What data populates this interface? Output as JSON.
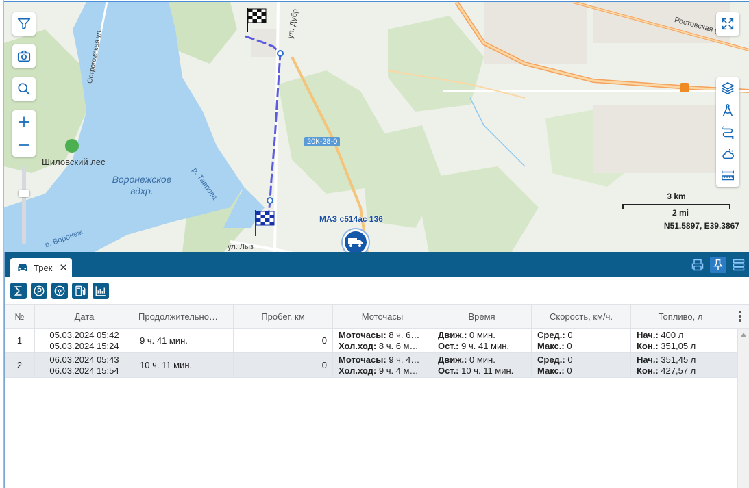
{
  "map": {
    "labels": {
      "shilovsky_les": "Шиловский лес",
      "reservoir": "Воронежское вдхр.",
      "tavrova": "р. Таврова",
      "voronezh_river": "р. Воронеж",
      "ostrogozhskaya": "Острогожская ул.",
      "rostovskaya": "Ростовская ул.",
      "dubr": "ул. Дубр",
      "lyzo": "ул. Лыз",
      "road_badge": "20К-28-0"
    },
    "vehicle_label": "МАЗ с514ас 136",
    "scale_km": "3 km",
    "scale_mi": "2 mi",
    "coords": "N51.5897, E39.3867"
  },
  "panel": {
    "tab_label": "Трек",
    "tab_close": "✕"
  },
  "grid": {
    "headers": [
      "№",
      "Дата",
      "Продолжительно…",
      "Пробег, км",
      "Моточасы",
      "Время",
      "Скорость, км/ч.",
      "Топливо, л"
    ],
    "rows": [
      {
        "num": "1",
        "date_start": "05.03.2024 05:42",
        "date_end": "05.03.2024 15:24",
        "duration": "9 ч. 41 мин.",
        "mileage": "0",
        "moto_label": "Моточасы:",
        "moto_value": " 8 ч. 6…",
        "idle_label": "Хол.ход:",
        "idle_value": " 8 ч. 6 м…",
        "move_label": "Движ.:",
        "move_value": " 0 мин.",
        "stop_label": "Ост.:",
        "stop_value": " 9 ч. 41 мин.",
        "avg_label": "Сред.:",
        "avg_value": " 0",
        "max_label": "Макс.:",
        "max_value": " 0",
        "fuel_start_label": "Нач.:",
        "fuel_start_value": " 400 л",
        "fuel_end_label": "Кон.:",
        "fuel_end_value": " 351,05 л"
      },
      {
        "num": "2",
        "date_start": "06.03.2024 05:43",
        "date_end": "06.03.2024 15:54",
        "duration": "10 ч. 11 мин.",
        "mileage": "0",
        "moto_label": "Моточасы:",
        "moto_value": " 9 ч. 4…",
        "idle_label": "Хол.ход:",
        "idle_value": " 9 ч. 4 м…",
        "move_label": "Движ.:",
        "move_value": " 0 мин.",
        "stop_label": "Ост.:",
        "stop_value": " 10 ч. 11 мин.",
        "avg_label": "Сред.:",
        "avg_value": " 0",
        "max_label": "Макс.:",
        "max_value": " 0",
        "fuel_start_label": "Нач.:",
        "fuel_start_value": " 351,45 л",
        "fuel_end_label": "Кон.:",
        "fuel_end_value": " 427,57 л"
      }
    ]
  }
}
